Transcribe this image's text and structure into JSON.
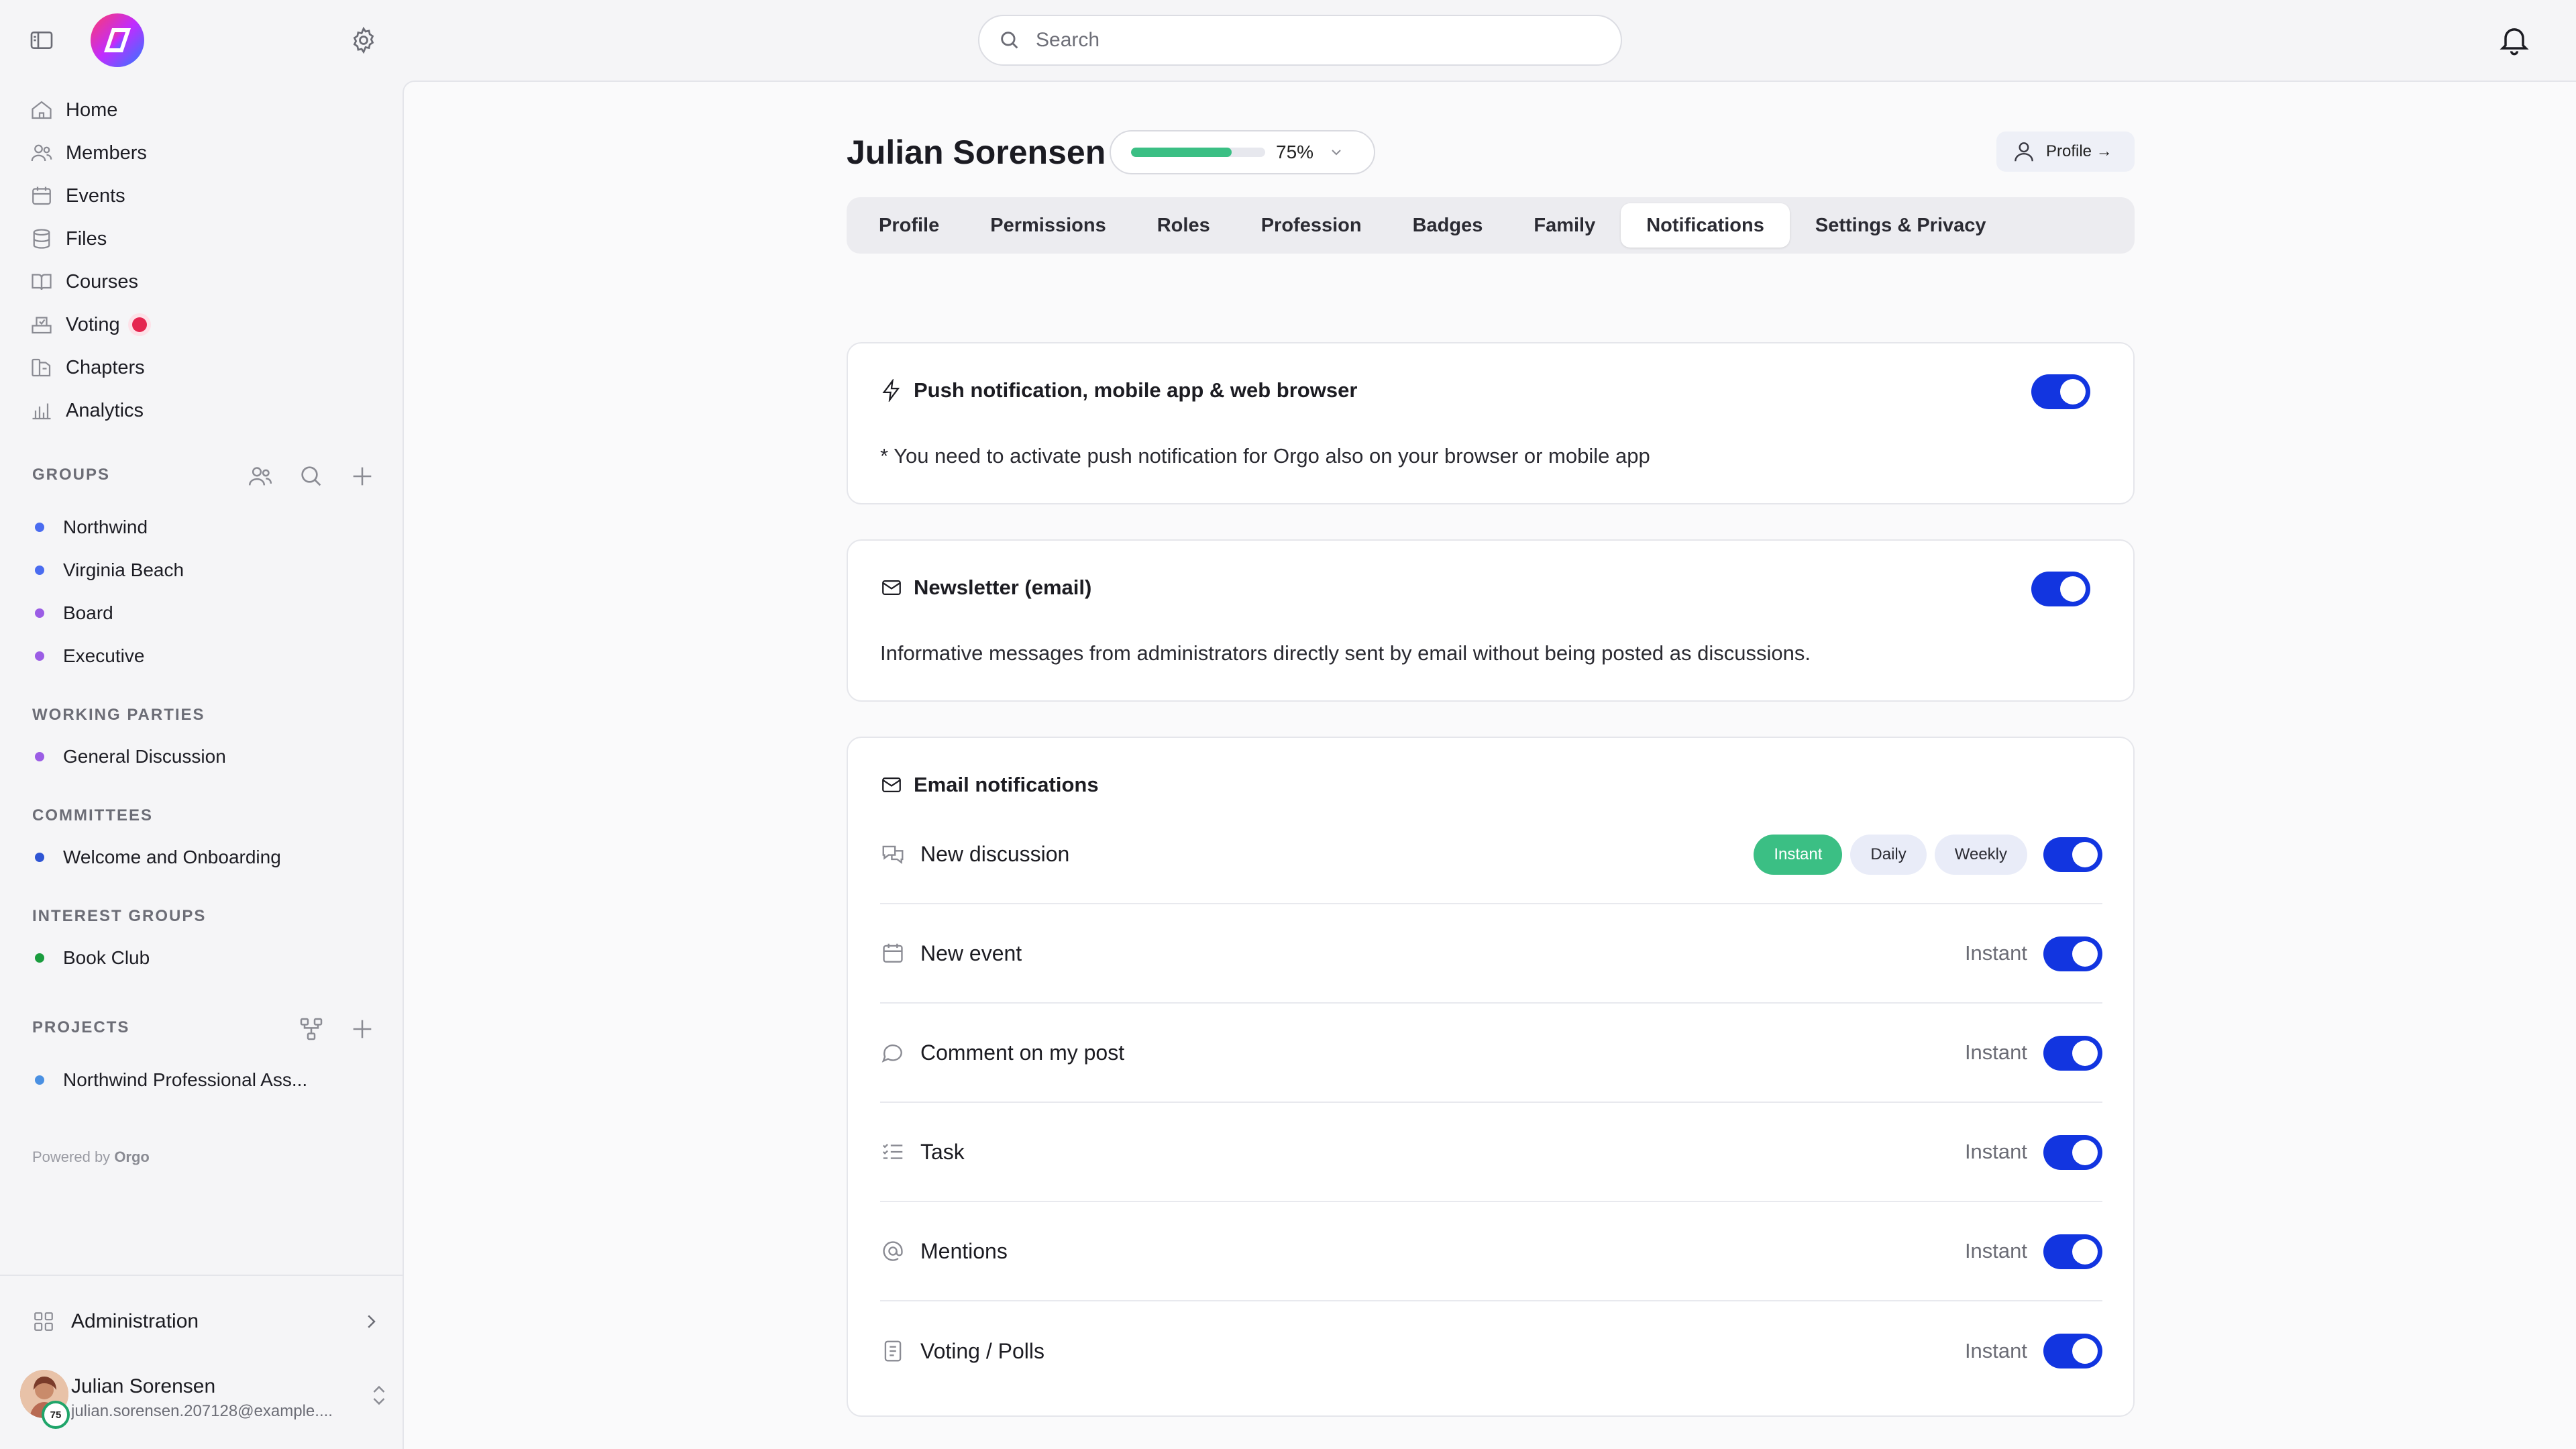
{
  "topbar": {
    "search_placeholder": "Search"
  },
  "sidebar": {
    "nav": [
      {
        "label": "Home",
        "icon": "home-icon"
      },
      {
        "label": "Members",
        "icon": "users-icon"
      },
      {
        "label": "Events",
        "icon": "calendar-icon"
      },
      {
        "label": "Files",
        "icon": "database-icon"
      },
      {
        "label": "Courses",
        "icon": "book-icon"
      },
      {
        "label": "Voting",
        "icon": "ballot-icon"
      },
      {
        "label": "Chapters",
        "icon": "chapters-icon"
      },
      {
        "label": "Analytics",
        "icon": "chart-icon"
      }
    ],
    "groups_heading": "GROUPS",
    "groups": [
      {
        "label": "Northwind",
        "color": "#4a6cf0"
      },
      {
        "label": "Virginia Beach",
        "color": "#4a6cf0"
      },
      {
        "label": "Board",
        "color": "#9b5de5"
      },
      {
        "label": "Executive",
        "color": "#9b5de5"
      }
    ],
    "working_parties_heading": "WORKING PARTIES",
    "working_parties": [
      {
        "label": "General Discussion",
        "color": "#9b5de5"
      }
    ],
    "committees_heading": "COMMITTEES",
    "committees": [
      {
        "label": "Welcome and Onboarding",
        "color": "#2f55d4"
      }
    ],
    "interest_groups_heading": "INTEREST GROUPS",
    "interest_groups": [
      {
        "label": "Book Club",
        "color": "#1a9c3e"
      }
    ],
    "projects_heading": "PROJECTS",
    "projects": [
      {
        "label": "Northwind Professional Ass...",
        "color": "#4a90e2"
      }
    ],
    "powered_by": "Powered by",
    "powered_brand": "Orgo",
    "admin_label": "Administration",
    "user": {
      "name": "Julian Sorensen",
      "email": "julian.sorensen.207128@example....",
      "badge": "75"
    }
  },
  "main": {
    "title": "Julian Sorensen",
    "progress_percent": 75,
    "progress_label": "75%",
    "profile_button": "Profile →",
    "tabs": [
      "Profile",
      "Permissions",
      "Roles",
      "Profession",
      "Badges",
      "Family",
      "Notifications",
      "Settings & Privacy"
    ],
    "active_tab": "Notifications",
    "push": {
      "title": "Push notification, mobile app & web browser",
      "text": "* You need to activate push notification for Orgo also on your browser or mobile app",
      "enabled": true
    },
    "newsletter": {
      "title": "Newsletter (email)",
      "text": "Informative messages from administrators directly sent by email without being posted as discussions.",
      "enabled": true
    },
    "email": {
      "title": "Email notifications",
      "frequency_options": [
        "Instant",
        "Daily",
        "Weekly"
      ],
      "rows": [
        {
          "label": "New discussion",
          "icon": "discussion-icon",
          "frequency": "Instant",
          "enabled": true
        },
        {
          "label": "New event",
          "icon": "calendar-icon",
          "frequency": "Instant",
          "enabled": true
        },
        {
          "label": "Comment on my post",
          "icon": "comment-icon",
          "frequency": "Instant",
          "enabled": true
        },
        {
          "label": "Task",
          "icon": "task-icon",
          "frequency": "Instant",
          "enabled": true
        },
        {
          "label": "Mentions",
          "icon": "at-icon",
          "frequency": "Instant",
          "enabled": true
        },
        {
          "label": "Voting / Polls",
          "icon": "poll-icon",
          "frequency": "Instant",
          "enabled": true
        }
      ]
    }
  },
  "colors": {
    "accent": "#1235e0",
    "success": "#3bbf84",
    "alert": "#e5254f"
  }
}
